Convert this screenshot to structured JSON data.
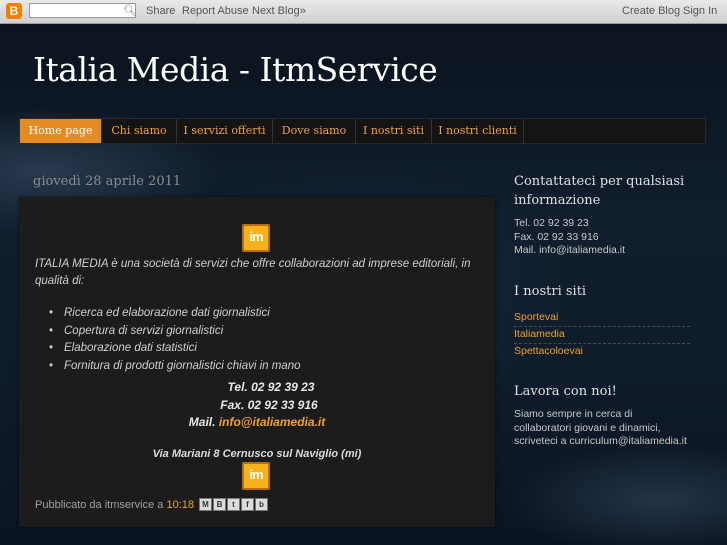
{
  "navbar": {
    "logo": "B",
    "search_placeholder": "",
    "links_left": [
      "Share",
      "Report Abuse",
      "Next Blog»"
    ],
    "links_right": [
      "Create Blog",
      "Sign In"
    ]
  },
  "header": {
    "title": "Italia Media - ItmService"
  },
  "tabs": [
    {
      "label": "Home page",
      "active": true
    },
    {
      "label": "Chi siamo",
      "active": false
    },
    {
      "label": "I servizi offerti",
      "active": false
    },
    {
      "label": "Dove siamo",
      "active": false
    },
    {
      "label": "I nostri siti",
      "active": false
    },
    {
      "label": "I nostri clienti",
      "active": false
    }
  ],
  "main": {
    "date": "giovedì 28 aprile 2011",
    "post": {
      "logo_text": "im",
      "intro": "ITALIA MEDIA è una società di servizi che offre collaborazioni ad imprese editoriali, in qualità di:",
      "bullets": [
        "Ricerca ed elaborazione dati giornalistici",
        "Copertura di servizi giornalistici",
        "Elaborazione dati statistici",
        "Fornitura di prodotti giornalistici chiavi in mano"
      ],
      "tel": "Tel. 02 92 39 23",
      "fax": "Fax. 02 92 33 916",
      "mail_label": "Mail.",
      "mail_link": "info@italiamedia.it",
      "address": "Via Mariani 8 Cernusco sul Naviglio (mi)",
      "footer_prefix": "Pubblicato da itmservice a",
      "footer_time": "10:18",
      "share_icons": [
        "email-icon",
        "blogthis-icon",
        "twitter-icon",
        "facebook-icon",
        "buzz-icon"
      ]
    }
  },
  "sidebar": {
    "contact": {
      "title_line1": "Contattateci per qualsiasi",
      "title_line2": "informazione",
      "tel": "Tel. 02 92 39 23",
      "fax": "Fax. 02 92 33 916",
      "mail": "Mail. info@italiamedia.it"
    },
    "sites": {
      "title": "I nostri siti",
      "links": [
        "Sportevai",
        "Italiamedia",
        "Spettacoloevai"
      ]
    },
    "jobs": {
      "title": "Lavora con noi!",
      "line1": "Siamo sempre in cerca di",
      "line2": "collaboratori giovani e dinamici,",
      "line3": "scriveteci a curriculum@italiamedia.it"
    }
  },
  "colors": {
    "accent": "#e48b24",
    "link": "#f0a030",
    "post_bg": "#1c1c1c"
  }
}
